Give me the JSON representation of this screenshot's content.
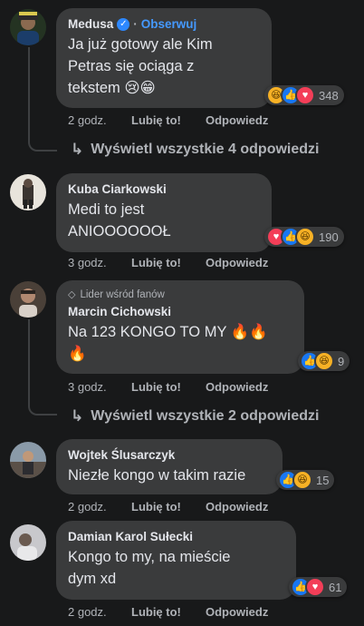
{
  "comments": [
    {
      "author": "Medusa",
      "verified": true,
      "follow_label": "Obserwuj",
      "text_lines": [
        "Ja już gotowy ale Kim",
        "Petras się ociąga z",
        "tekstem 😢😁"
      ],
      "time": "2 godz.",
      "like_label": "Lubię to!",
      "reply_label": "Odpowiedz",
      "reactions": [
        "haha",
        "like",
        "love"
      ],
      "reaction_count": "348",
      "view_replies": "Wyświetl wszystkie 4 odpowiedzi"
    },
    {
      "author": "Kuba Ciarkowski",
      "text_lines": [
        "Medi to jest",
        "ANIOOOOOOŁ"
      ],
      "time": "3 godz.",
      "like_label": "Lubię to!",
      "reply_label": "Odpowiedz",
      "reactions": [
        "love",
        "like",
        "haha"
      ],
      "reaction_count": "190"
    },
    {
      "badge": "Lider wśród fanów",
      "author": "Marcin Cichowski",
      "text_lines": [
        "Na 123 KONGO TO MY 🔥🔥",
        "🔥"
      ],
      "time": "3 godz.",
      "like_label": "Lubię to!",
      "reply_label": "Odpowiedz",
      "reactions": [
        "like",
        "haha"
      ],
      "reaction_count": "9",
      "view_replies": "Wyświetl wszystkie 2 odpowiedzi"
    },
    {
      "author": "Wojtek Ślusarczyk",
      "text_lines": [
        "Niezłe kongo w takim razie"
      ],
      "time": "2 godz.",
      "like_label": "Lubię to!",
      "reply_label": "Odpowiedz",
      "reactions": [
        "like",
        "haha"
      ],
      "reaction_count": "15"
    },
    {
      "author": "Damian Karol Sułecki",
      "text_lines": [
        "Kongo to my, na mieście",
        "dym xd"
      ],
      "time": "2 godz.",
      "like_label": "Lubię to!",
      "reply_label": "Odpowiedz",
      "reactions": [
        "like",
        "love"
      ],
      "reaction_count": "61"
    }
  ],
  "colors": {
    "background": "#18191a",
    "bubble": "#3a3b3c",
    "link_blue": "#4599ff",
    "muted": "#b0b3b8",
    "like_blue": "#1877f2",
    "love_red": "#f33e58",
    "haha_yellow": "#f7b125"
  }
}
